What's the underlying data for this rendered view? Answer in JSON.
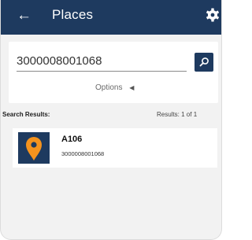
{
  "appbar": {
    "title": "Places",
    "back_icon": "arrow-left-icon",
    "settings_icon": "gear-icon",
    "color": "#1e3a5f"
  },
  "search": {
    "value": "3000008001068",
    "search_icon": "search-icon",
    "options_label": "Options",
    "options_icon": "triangle-left-icon"
  },
  "results": {
    "label": "Search Results:",
    "count": "Results:  1  of  1",
    "items": [
      {
        "name": "A106",
        "id": "3000008001068",
        "icon": "map-pin-icon",
        "pin_color": "#f5931e"
      }
    ]
  }
}
